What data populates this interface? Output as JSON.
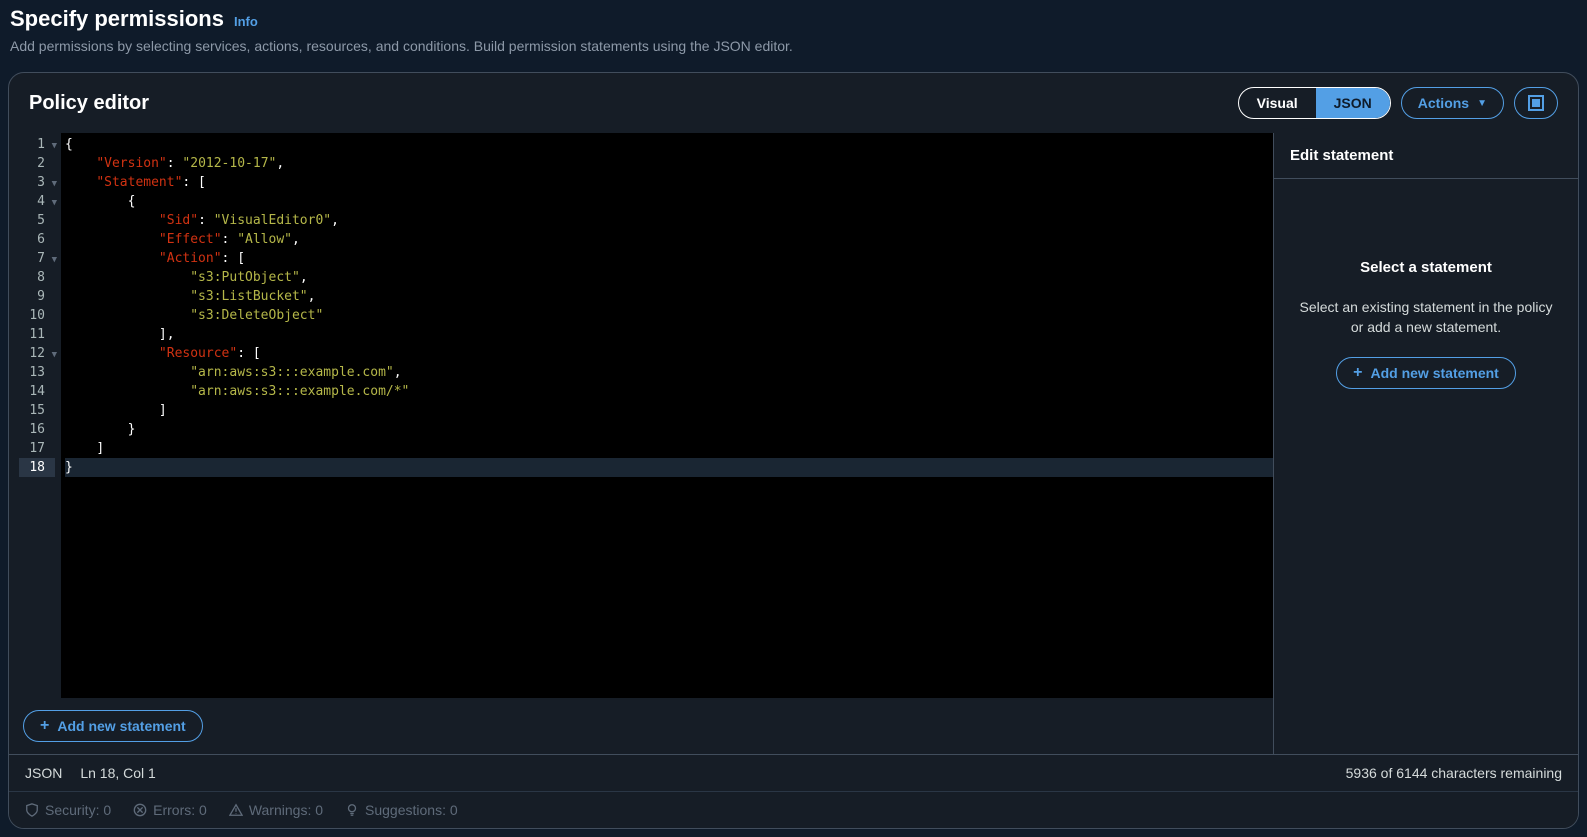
{
  "header": {
    "title": "Specify permissions",
    "info_link": "Info",
    "description": "Add permissions by selecting services, actions, resources, and conditions. Build permission statements using the JSON editor."
  },
  "toolbar": {
    "title": "Policy editor",
    "toggle_visual": "Visual",
    "toggle_json": "JSON",
    "actions_label": "Actions"
  },
  "editor": {
    "lines": [
      {
        "n": 1,
        "fold": true,
        "tokens": [
          [
            "pun",
            "{"
          ]
        ]
      },
      {
        "n": 2,
        "fold": false,
        "tokens": [
          [
            "ind",
            "    "
          ],
          [
            "key",
            "\"Version\""
          ],
          [
            "pun",
            ": "
          ],
          [
            "str",
            "\"2012-10-17\""
          ],
          [
            "pun",
            ","
          ]
        ]
      },
      {
        "n": 3,
        "fold": true,
        "tokens": [
          [
            "ind",
            "    "
          ],
          [
            "key",
            "\"Statement\""
          ],
          [
            "pun",
            ": ["
          ]
        ]
      },
      {
        "n": 4,
        "fold": true,
        "tokens": [
          [
            "ind",
            "        "
          ],
          [
            "pun",
            "{"
          ]
        ]
      },
      {
        "n": 5,
        "fold": false,
        "tokens": [
          [
            "ind",
            "            "
          ],
          [
            "key",
            "\"Sid\""
          ],
          [
            "pun",
            ": "
          ],
          [
            "str",
            "\"VisualEditor0\""
          ],
          [
            "pun",
            ","
          ]
        ]
      },
      {
        "n": 6,
        "fold": false,
        "tokens": [
          [
            "ind",
            "            "
          ],
          [
            "key",
            "\"Effect\""
          ],
          [
            "pun",
            ": "
          ],
          [
            "str",
            "\"Allow\""
          ],
          [
            "pun",
            ","
          ]
        ]
      },
      {
        "n": 7,
        "fold": true,
        "tokens": [
          [
            "ind",
            "            "
          ],
          [
            "key",
            "\"Action\""
          ],
          [
            "pun",
            ": ["
          ]
        ]
      },
      {
        "n": 8,
        "fold": false,
        "tokens": [
          [
            "ind",
            "                "
          ],
          [
            "str",
            "\"s3:PutObject\""
          ],
          [
            "pun",
            ","
          ]
        ]
      },
      {
        "n": 9,
        "fold": false,
        "tokens": [
          [
            "ind",
            "                "
          ],
          [
            "str",
            "\"s3:ListBucket\""
          ],
          [
            "pun",
            ","
          ]
        ]
      },
      {
        "n": 10,
        "fold": false,
        "tokens": [
          [
            "ind",
            "                "
          ],
          [
            "str",
            "\"s3:DeleteObject\""
          ]
        ]
      },
      {
        "n": 11,
        "fold": false,
        "tokens": [
          [
            "ind",
            "            "
          ],
          [
            "pun",
            "],"
          ]
        ]
      },
      {
        "n": 12,
        "fold": true,
        "tokens": [
          [
            "ind",
            "            "
          ],
          [
            "key",
            "\"Resource\""
          ],
          [
            "pun",
            ": ["
          ]
        ]
      },
      {
        "n": 13,
        "fold": false,
        "tokens": [
          [
            "ind",
            "                "
          ],
          [
            "str",
            "\"arn:aws:s3:::example.com\""
          ],
          [
            "pun",
            ","
          ]
        ]
      },
      {
        "n": 14,
        "fold": false,
        "tokens": [
          [
            "ind",
            "                "
          ],
          [
            "str",
            "\"arn:aws:s3:::example.com/*\""
          ]
        ]
      },
      {
        "n": 15,
        "fold": false,
        "tokens": [
          [
            "ind",
            "            "
          ],
          [
            "pun",
            "]"
          ]
        ]
      },
      {
        "n": 16,
        "fold": false,
        "tokens": [
          [
            "ind",
            "        "
          ],
          [
            "pun",
            "}"
          ]
        ]
      },
      {
        "n": 17,
        "fold": false,
        "tokens": [
          [
            "ind",
            "    "
          ],
          [
            "pun",
            "]"
          ]
        ]
      },
      {
        "n": 18,
        "fold": false,
        "tokens": [
          [
            "pun",
            "}"
          ]
        ]
      }
    ],
    "active_line": 18,
    "add_new_statement": "Add new statement"
  },
  "right_pane": {
    "header": "Edit statement",
    "title": "Select a statement",
    "description": "Select an existing statement in the policy or add a new statement.",
    "add_button": "Add new statement"
  },
  "status": {
    "mode": "JSON",
    "cursor": "Ln 18, Col 1",
    "chars_remaining": "5936 of 6144 characters remaining"
  },
  "footer": {
    "security": "Security: 0",
    "errors": "Errors: 0",
    "warnings": "Warnings: 0",
    "suggestions": "Suggestions: 0"
  }
}
